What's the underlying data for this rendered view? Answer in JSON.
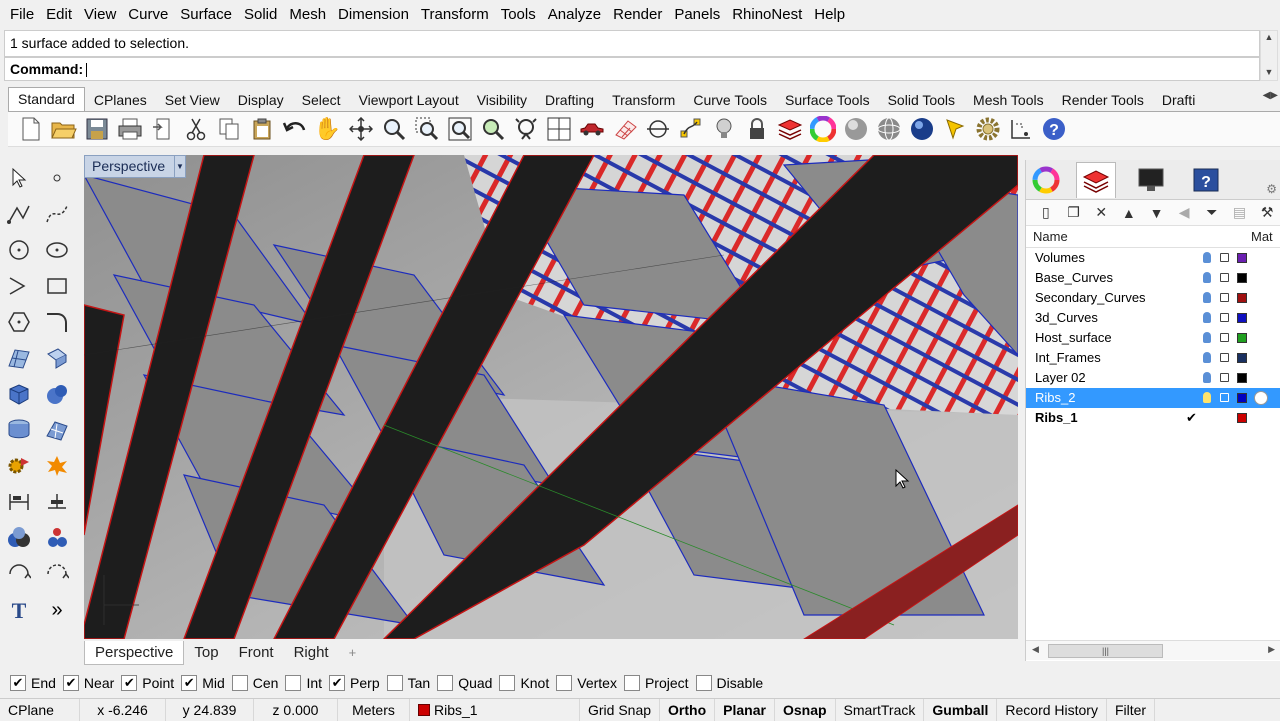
{
  "menu": [
    "File",
    "Edit",
    "View",
    "Curve",
    "Surface",
    "Solid",
    "Mesh",
    "Dimension",
    "Transform",
    "Tools",
    "Analyze",
    "Render",
    "Panels",
    "RhinoNest",
    "Help"
  ],
  "command_history": "1 surface added to selection.",
  "command_prompt": "Command:",
  "toolbar_tabs": [
    "Standard",
    "CPlanes",
    "Set View",
    "Display",
    "Select",
    "Viewport Layout",
    "Visibility",
    "Drafting",
    "Transform",
    "Curve Tools",
    "Surface Tools",
    "Solid Tools",
    "Mesh Tools",
    "Render Tools",
    "Drafti"
  ],
  "active_toolbar_tab": "Standard",
  "toolbar_icons": [
    "new-file-icon",
    "open-folder-icon",
    "save-icon",
    "print-icon",
    "import-icon",
    "cut-icon",
    "copy-icon",
    "paste-icon",
    "undo-icon",
    "pan-hand-icon",
    "rotate-view-icon",
    "zoom-icon",
    "zoom-window-icon",
    "zoom-extents-icon",
    "zoom-selected-icon",
    "zoom-target-icon",
    "four-viewports-icon",
    "car-render-icon",
    "grid-icon",
    "point-osnap-icon",
    "curve-edit-icon",
    "lightbulb-icon",
    "lock-icon",
    "layers-icon",
    "color-wheel-icon",
    "shaded-sphere-icon",
    "wireframe-sphere-icon",
    "blue-sphere-icon",
    "light-icon",
    "settings-gears-icon",
    "dimension-icon",
    "help-icon"
  ],
  "viewport": {
    "title": "Perspective",
    "tabs": [
      "Perspective",
      "Top",
      "Front",
      "Right"
    ],
    "active_tab": "Perspective",
    "add_tab": "+"
  },
  "layers_panel": {
    "header_name": "Name",
    "header_material": "Mat",
    "layers": [
      {
        "name": "Volumes",
        "color": "#6a1fb0",
        "selected": false,
        "current": false
      },
      {
        "name": "Base_Curves",
        "color": "#000000",
        "selected": false,
        "current": false
      },
      {
        "name": "Secondary_Curves",
        "color": "#a01010",
        "selected": false,
        "current": false
      },
      {
        "name": "3d_Curves",
        "color": "#1010c0",
        "selected": false,
        "current": false
      },
      {
        "name": "Host_surface",
        "color": "#20a020",
        "selected": false,
        "current": false
      },
      {
        "name": "Int_Frames",
        "color": "#1a3060",
        "selected": false,
        "current": false
      },
      {
        "name": "Layer 02",
        "color": "#000000",
        "selected": false,
        "current": false
      },
      {
        "name": "Ribs_2",
        "color": "#0000c0",
        "selected": true,
        "current": false
      },
      {
        "name": "Ribs_1",
        "color": "#cc0000",
        "selected": false,
        "current": true
      }
    ]
  },
  "osnaps": [
    {
      "label": "End",
      "checked": true
    },
    {
      "label": "Near",
      "checked": true
    },
    {
      "label": "Point",
      "checked": true
    },
    {
      "label": "Mid",
      "checked": true
    },
    {
      "label": "Cen",
      "checked": false
    },
    {
      "label": "Int",
      "checked": false
    },
    {
      "label": "Perp",
      "checked": true
    },
    {
      "label": "Tan",
      "checked": false
    },
    {
      "label": "Quad",
      "checked": false
    },
    {
      "label": "Knot",
      "checked": false
    },
    {
      "label": "Vertex",
      "checked": false
    },
    {
      "label": "Project",
      "checked": false
    },
    {
      "label": "Disable",
      "checked": false
    }
  ],
  "status": {
    "cplane": "CPlane",
    "x": "x -6.246",
    "y": "y 24.839",
    "z": "z 0.000",
    "units": "Meters",
    "layer": "Ribs_1",
    "layer_color": "#cc0000",
    "toggles": [
      {
        "label": "Grid Snap",
        "bold": false
      },
      {
        "label": "Ortho",
        "bold": true
      },
      {
        "label": "Planar",
        "bold": true
      },
      {
        "label": "Osnap",
        "bold": true
      },
      {
        "label": "SmartTrack",
        "bold": false
      },
      {
        "label": "Gumball",
        "bold": true
      },
      {
        "label": "Record History",
        "bold": false
      },
      {
        "label": "Filter",
        "bold": false
      }
    ]
  }
}
